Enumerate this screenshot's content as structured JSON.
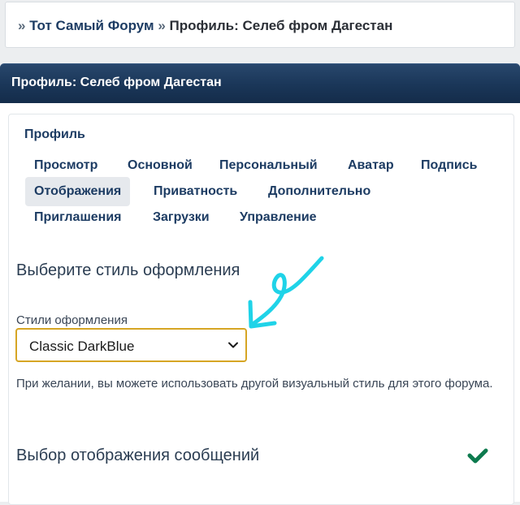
{
  "breadcrumb": {
    "sep1": "»",
    "forum_link": "Тот Самый Форум",
    "sep2": "»",
    "current": "Профиль: Селеб фром Дагестан"
  },
  "panel": {
    "title": "Профиль: Селеб фром Дагестан"
  },
  "profile_menu": {
    "heading": "Профиль",
    "tabs": [
      {
        "label": "Просмотр"
      },
      {
        "label": "Основной"
      },
      {
        "label": "Персональный"
      },
      {
        "label": "Аватар"
      },
      {
        "label": "Подпись"
      },
      {
        "label": "Отображения",
        "active": true
      },
      {
        "label": "Приватность"
      },
      {
        "label": "Дополнительно"
      },
      {
        "label": "Приглашения"
      },
      {
        "label": "Загрузки"
      },
      {
        "label": "Управление"
      }
    ]
  },
  "style_section": {
    "title": "Выберите стиль оформления",
    "field_label": "Стили оформления",
    "selected_value": "Classic DarkBlue",
    "hint": "При желании, вы можете использовать другой визуальный стиль для этого форума."
  },
  "messages_section": {
    "title": "Выбор отображения сообщений"
  },
  "colors": {
    "header_bg": "#1a3658",
    "select_border": "#d6a524",
    "annotation_arrow": "#1fd3e8",
    "check_icon": "#0d7a4e"
  },
  "icons": {
    "select_chevron": "chevron-down-icon",
    "section_toggle": "check-icon",
    "annotation": "arrow-icon"
  }
}
